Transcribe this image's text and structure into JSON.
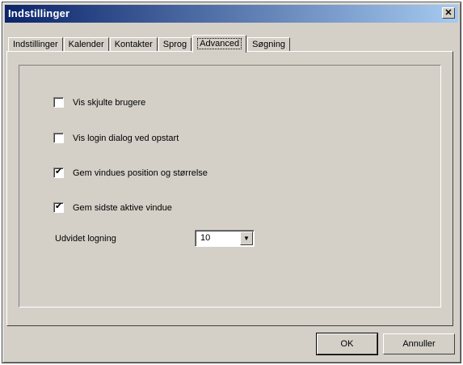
{
  "window": {
    "title": "Indstillinger",
    "close_glyph": "✕"
  },
  "tabs": [
    {
      "label": "Indstillinger",
      "active": false
    },
    {
      "label": "Kalender",
      "active": false
    },
    {
      "label": "Kontakter",
      "active": false
    },
    {
      "label": "Sprog",
      "active": false
    },
    {
      "label": "Advanced",
      "active": true
    },
    {
      "label": "Søgning",
      "active": false
    }
  ],
  "options": [
    {
      "label": "Vis skjulte brugere",
      "checked": false
    },
    {
      "label": "Vis login dialog ved opstart",
      "checked": false
    },
    {
      "label": "Gem vindues position og størrelse",
      "checked": true
    },
    {
      "label": "Gem sidste aktive vindue",
      "checked": true
    }
  ],
  "logging": {
    "label": "Udvidet logning",
    "value": "10"
  },
  "buttons": {
    "ok": "OK",
    "cancel": "Annuller"
  }
}
